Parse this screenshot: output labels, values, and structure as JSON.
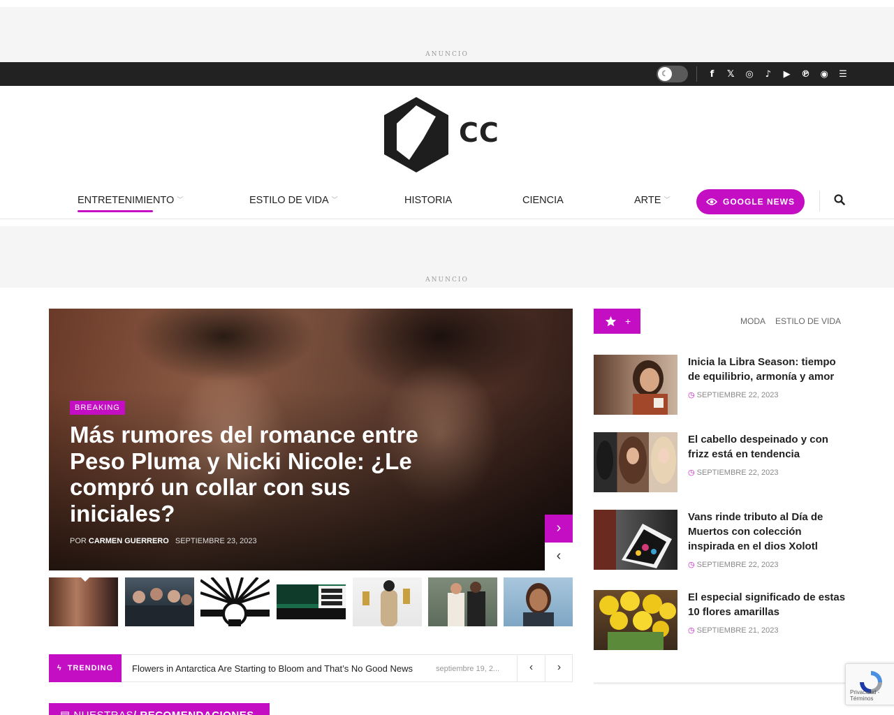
{
  "ads": {
    "top_label": "ANUNCIO",
    "mid_label": "ANUNCIO"
  },
  "topbar": {
    "dark_mode_toggle": "off",
    "socials": [
      "facebook-icon",
      "x-icon",
      "instagram-icon",
      "tiktok-icon",
      "youtube-icon",
      "pinterest-icon",
      "snapchat-icon",
      "rss-icon"
    ],
    "social_glyphs": [
      "f",
      "𝕏",
      "◎",
      "♪",
      "▶",
      "℗",
      "◉",
      "☰"
    ]
  },
  "logo": {
    "text": "CC"
  },
  "nav": {
    "items": [
      {
        "label": "ENTRETENIMIENTO",
        "dropdown": true,
        "active": true
      },
      {
        "label": "ESTILO DE VIDA",
        "dropdown": true,
        "active": false
      },
      {
        "label": "HISTORIA",
        "dropdown": false,
        "active": false
      },
      {
        "label": "CIENCIA",
        "dropdown": false,
        "active": false
      },
      {
        "label": "ARTE",
        "dropdown": true,
        "active": false
      }
    ],
    "google_news": "GOOGLE NEWS",
    "accent": "#c40ec4"
  },
  "hero": {
    "badge": "BREAKING",
    "title": "Más rumores del romance entre Peso Pluma y Nicki Nicole: ¿Le compró un collar con sus iniciales?",
    "by": "POR",
    "author": "CARMEN GUERRERO",
    "date": "SEPTIEMBRE 23, 2023"
  },
  "thumbnails": [
    "thumb-couple",
    "thumb-group",
    "thumb-logo",
    "thumb-poster",
    "thumb-award",
    "thumb-couple-2",
    "thumb-woman"
  ],
  "trending": {
    "label": "TRENDING",
    "headline": "Flowers in Antarctica Are Starting to Bloom and That’s No Good News",
    "date": "septiembre 19, 2..."
  },
  "recommendations": {
    "prefix": "NUESTRAS",
    "title": "/ RECOMENDACIONES"
  },
  "sidebar": {
    "plus": "+",
    "tabs": [
      "MODA",
      "ESTILO DE VIDA"
    ],
    "articles": [
      {
        "title": "Inicia la Libra Season: tiempo de equilibrio, armonía y amor",
        "date": "SEPTIEMBRE 22, 2023"
      },
      {
        "title": "El cabello despeinado y con frizz está en tendencia",
        "date": "SEPTIEMBRE 22, 2023"
      },
      {
        "title": "Vans rinde tributo al Día de Muertos con colección inspirada en el dios Xolotl",
        "date": "SEPTIEMBRE 22, 2023"
      },
      {
        "title": "El especial significado de estas 10 flores amarillas",
        "date": "SEPTIEMBRE 21, 2023"
      }
    ]
  },
  "recaptcha": {
    "text": "Privacidad - Términos"
  }
}
